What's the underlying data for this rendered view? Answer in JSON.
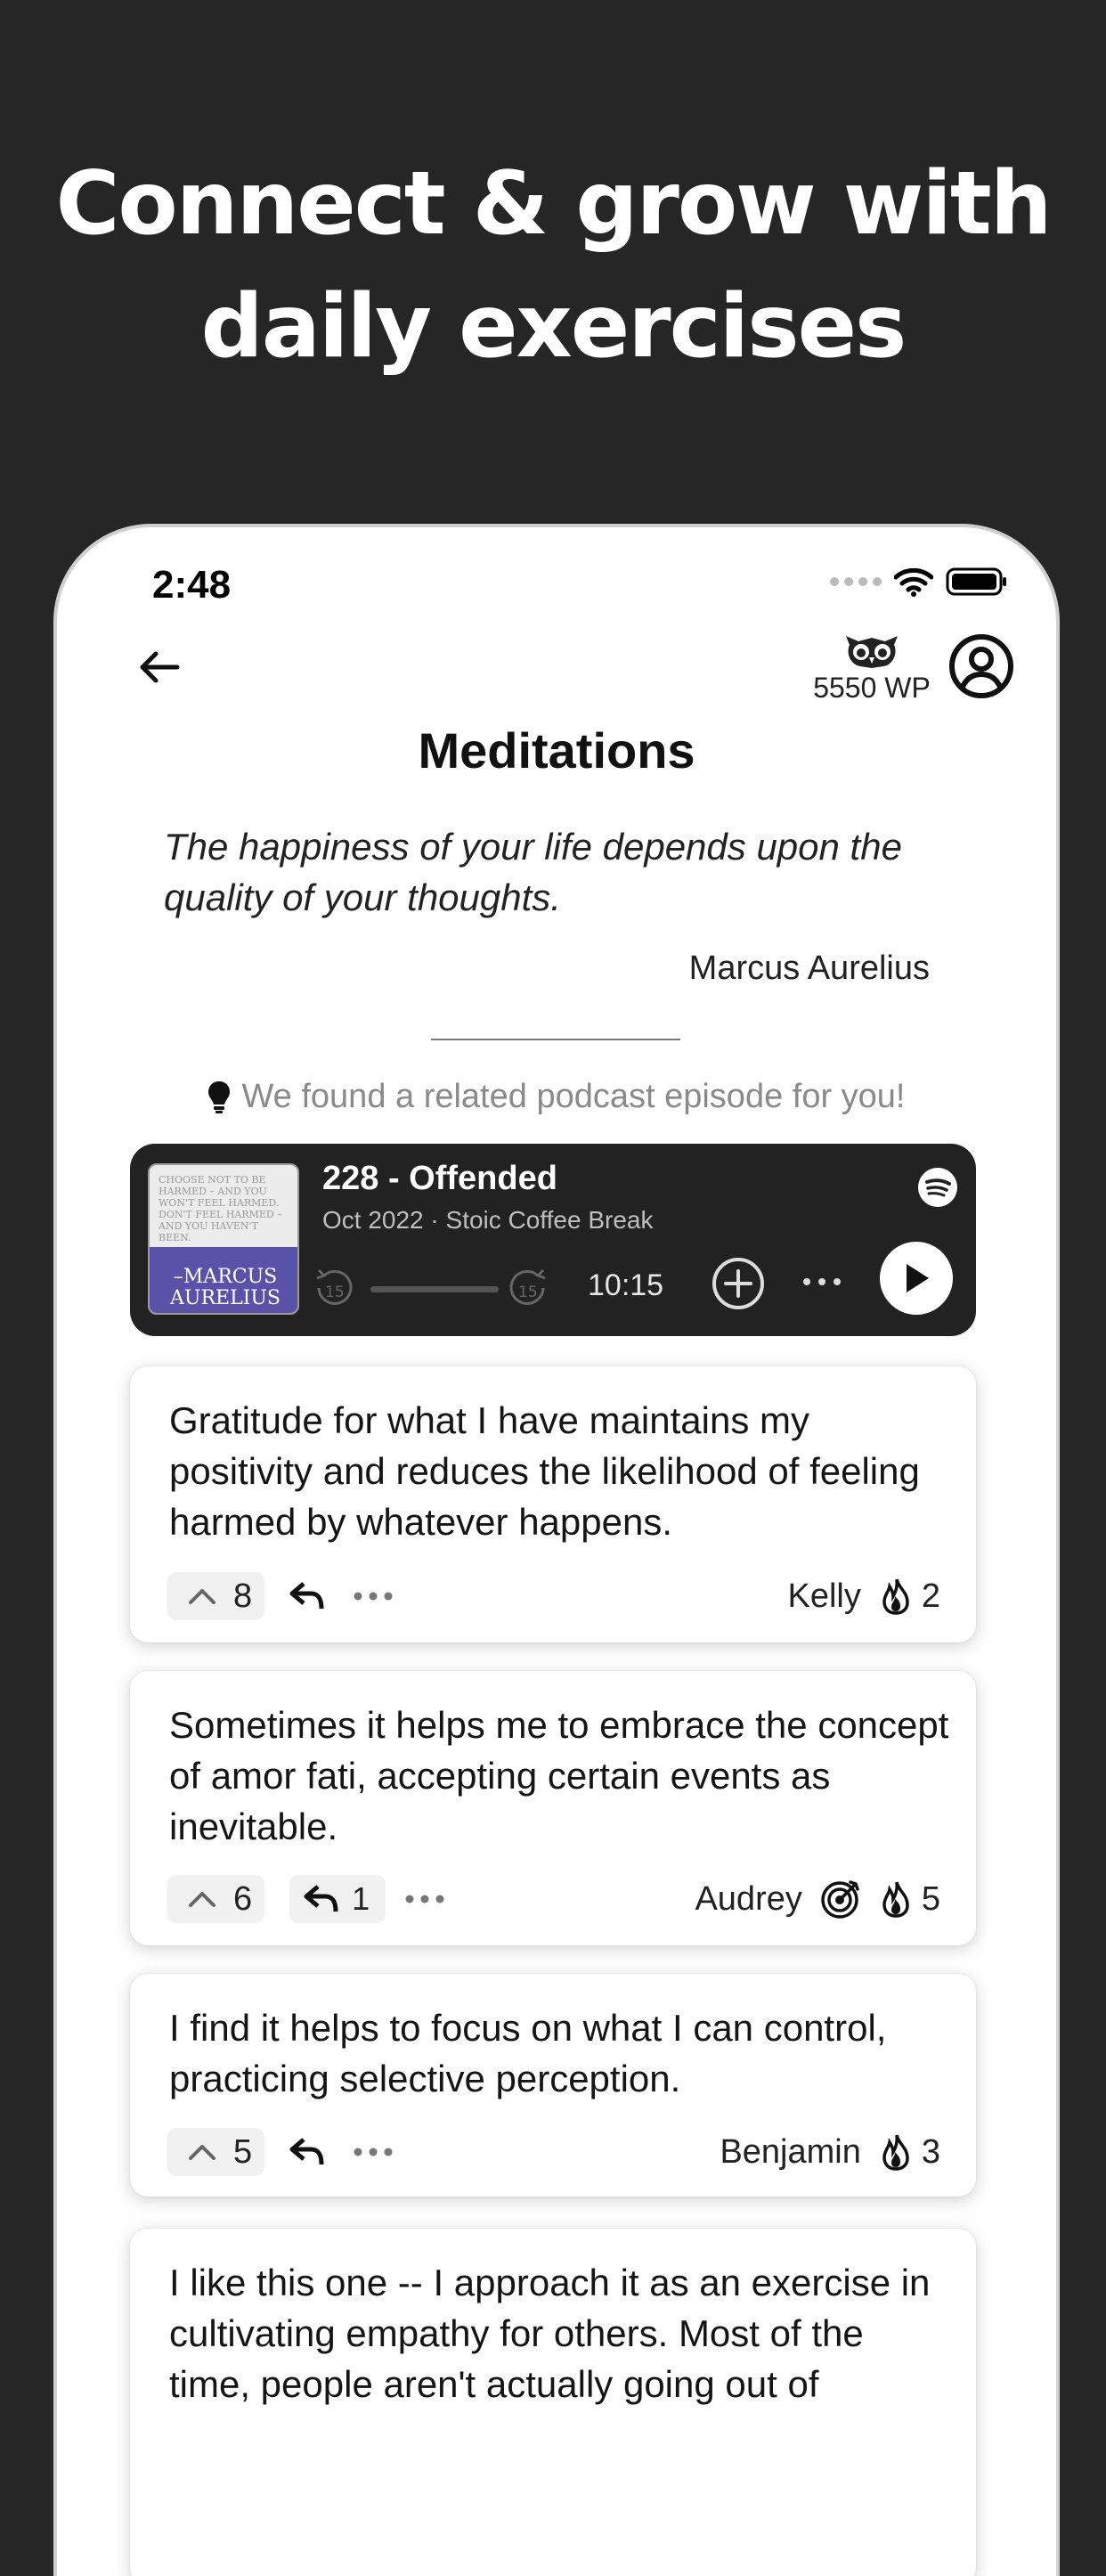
{
  "headline": {
    "line1": "Connect & grow with",
    "line2": "daily exercises"
  },
  "status_bar": {
    "time": "2:48"
  },
  "header": {
    "wp_label": "5550 WP"
  },
  "page": {
    "title": "Meditations",
    "quote": "The happiness of your life depends upon the quality of your thoughts.",
    "author": "Marcus Aurelius",
    "hint": "We found a related podcast episode for you!"
  },
  "podcast": {
    "cover_text": "CHOOSE NOT TO BE HARMED – AND YOU WON'T FEEL HARMED. DON'T FEEL HARMED – AND YOU HAVEN'T BEEN.",
    "cover_author": "–MARCUS AURELIUS",
    "title": "228 - Offended",
    "date": "Oct 2022",
    "separator": "·",
    "show": "Stoic Coffee Break",
    "skip_back": "15",
    "skip_forward": "15",
    "duration": "10:15"
  },
  "responses": [
    {
      "text": "Gratitude for what I have maintains my positivity and reduces the likelihood of feeling harmed by whatever happens.",
      "votes": "8",
      "replies": "",
      "user": "Kelly",
      "streak": "2"
    },
    {
      "text": "Sometimes it helps me to embrace the concept of amor fati, accepting certain events as inevitable.",
      "votes": "6",
      "replies": "1",
      "user": "Audrey",
      "streak": "5"
    },
    {
      "text": "I find it helps to focus on what I can control, practicing selective perception.",
      "votes": "5",
      "replies": "",
      "user": "Benjamin",
      "streak": "3"
    },
    {
      "text": "I like this one -- I approach it as an exercise in cultivating empathy for others. Most of the time, people aren't actually going out of"
    }
  ],
  "colors": {
    "background": "#262627",
    "podcast_card": "#222222",
    "cover_band": "#5a52a8"
  },
  "icons": [
    "back-arrow-icon",
    "owl-icon",
    "profile-icon",
    "lightbulb-icon",
    "spotify-icon",
    "skip-back-icon",
    "skip-forward-icon",
    "add-circle-icon",
    "more-icon",
    "play-icon",
    "upvote-icon",
    "reply-icon",
    "target-icon",
    "fire-icon"
  ]
}
